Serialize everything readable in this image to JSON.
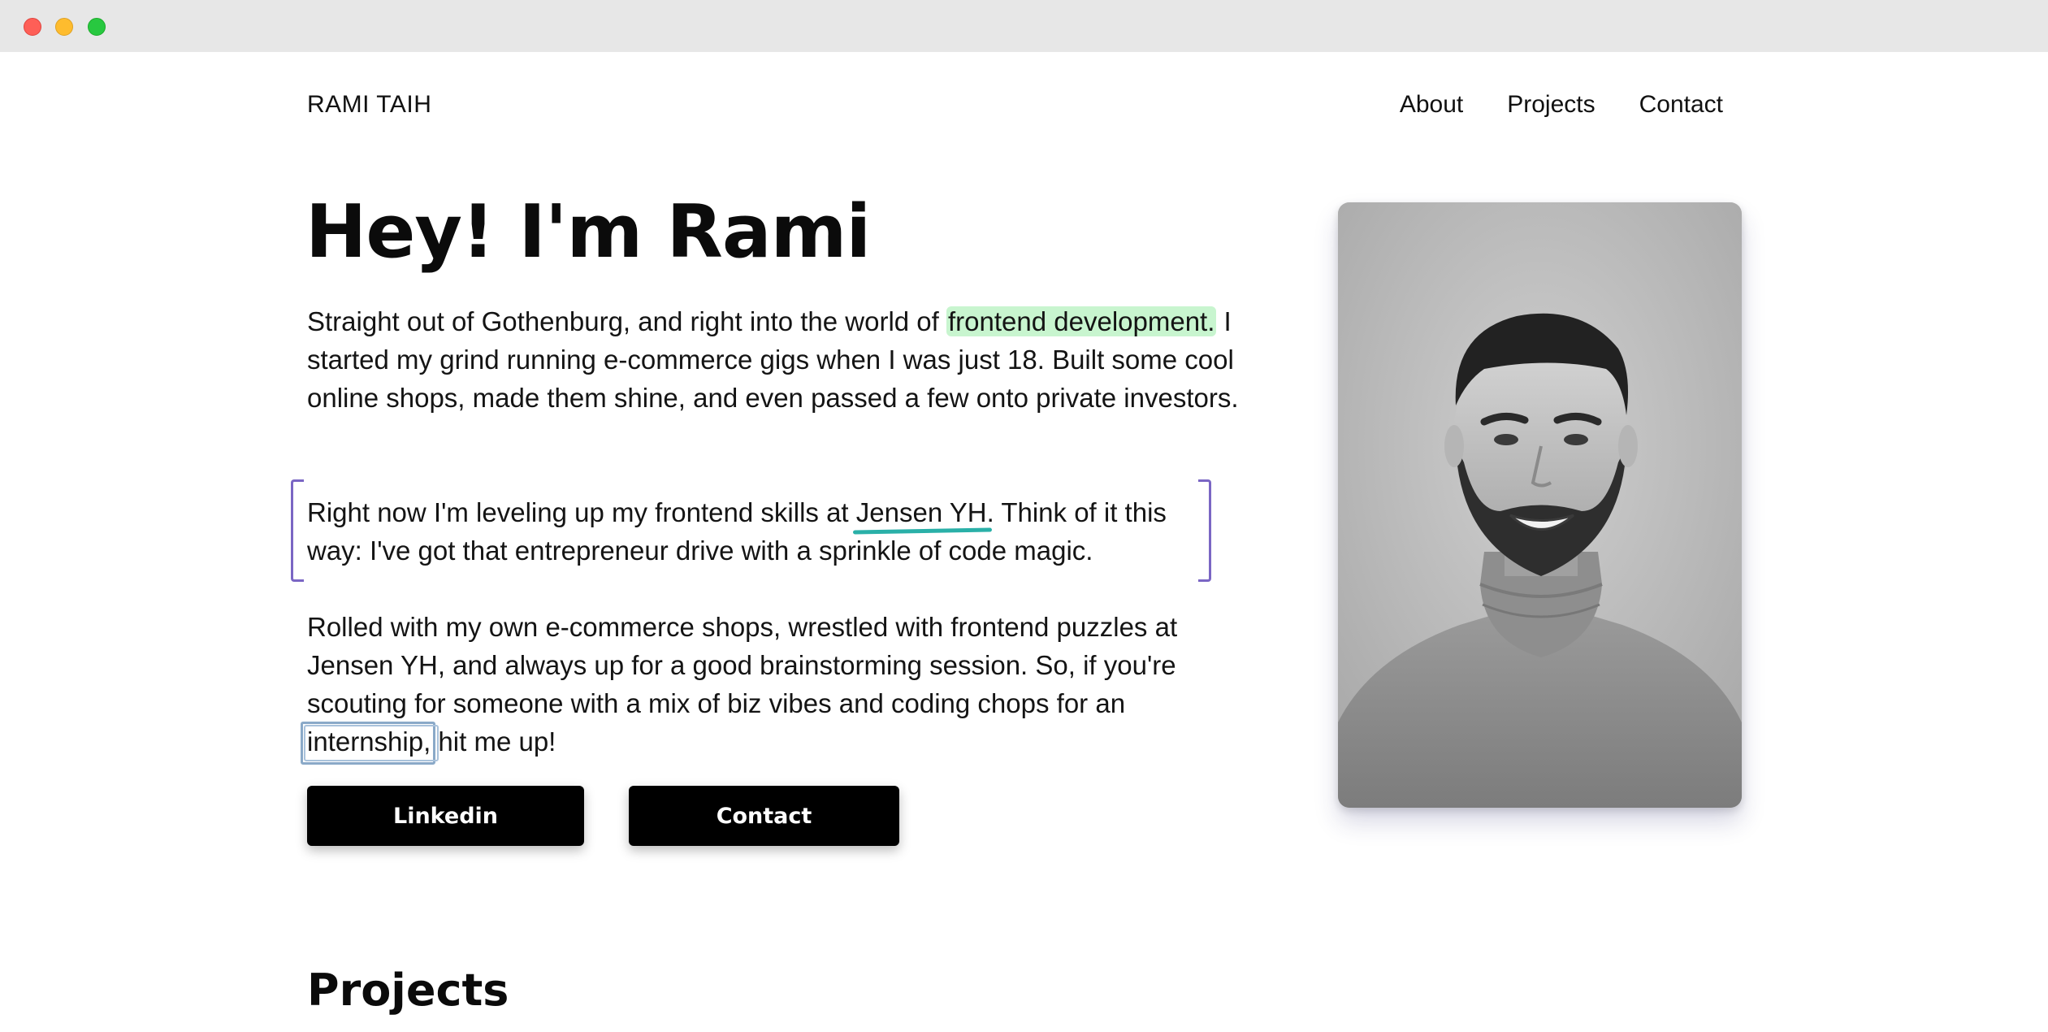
{
  "window": {
    "controls": [
      "close",
      "minimize",
      "maximize"
    ]
  },
  "header": {
    "brand": "RAMI TAIH",
    "nav": [
      {
        "label": "About"
      },
      {
        "label": "Projects"
      },
      {
        "label": "Contact"
      }
    ]
  },
  "hero": {
    "title": "Hey! I'm Rami",
    "p1": {
      "before": "Straight out of Gothenburg, and right into the world of ",
      "highlight": "frontend development.",
      "after": " I started my grind running e-commerce gigs when I was just 18. Built some cool online shops, made them shine, and even passed a few onto private investors."
    },
    "p2": {
      "before": "Right now I'm leveling up my frontend skills at ",
      "underlined": "Jensen YH",
      "after": ". Think of it this way: I've got that entrepreneur drive with a sprinkle of code magic."
    },
    "p3": {
      "before": "Rolled with my own e-commerce shops, wrestled with frontend puzzles at Jensen YH, and always up for a good brainstorming session. So, if you're scouting for someone with a mix of biz vibes and coding chops for an ",
      "boxed": "internship,",
      "after": " hit me up!"
    },
    "buttons": {
      "linkedin": "Linkedin",
      "contact": "Contact"
    },
    "accent_colors": {
      "highlight": "#c8f5cf",
      "underline": "#2ab0a8",
      "bracket": "#7a66c4",
      "box": "#8aa9c8"
    }
  },
  "sections": {
    "projects_title": "Projects"
  }
}
